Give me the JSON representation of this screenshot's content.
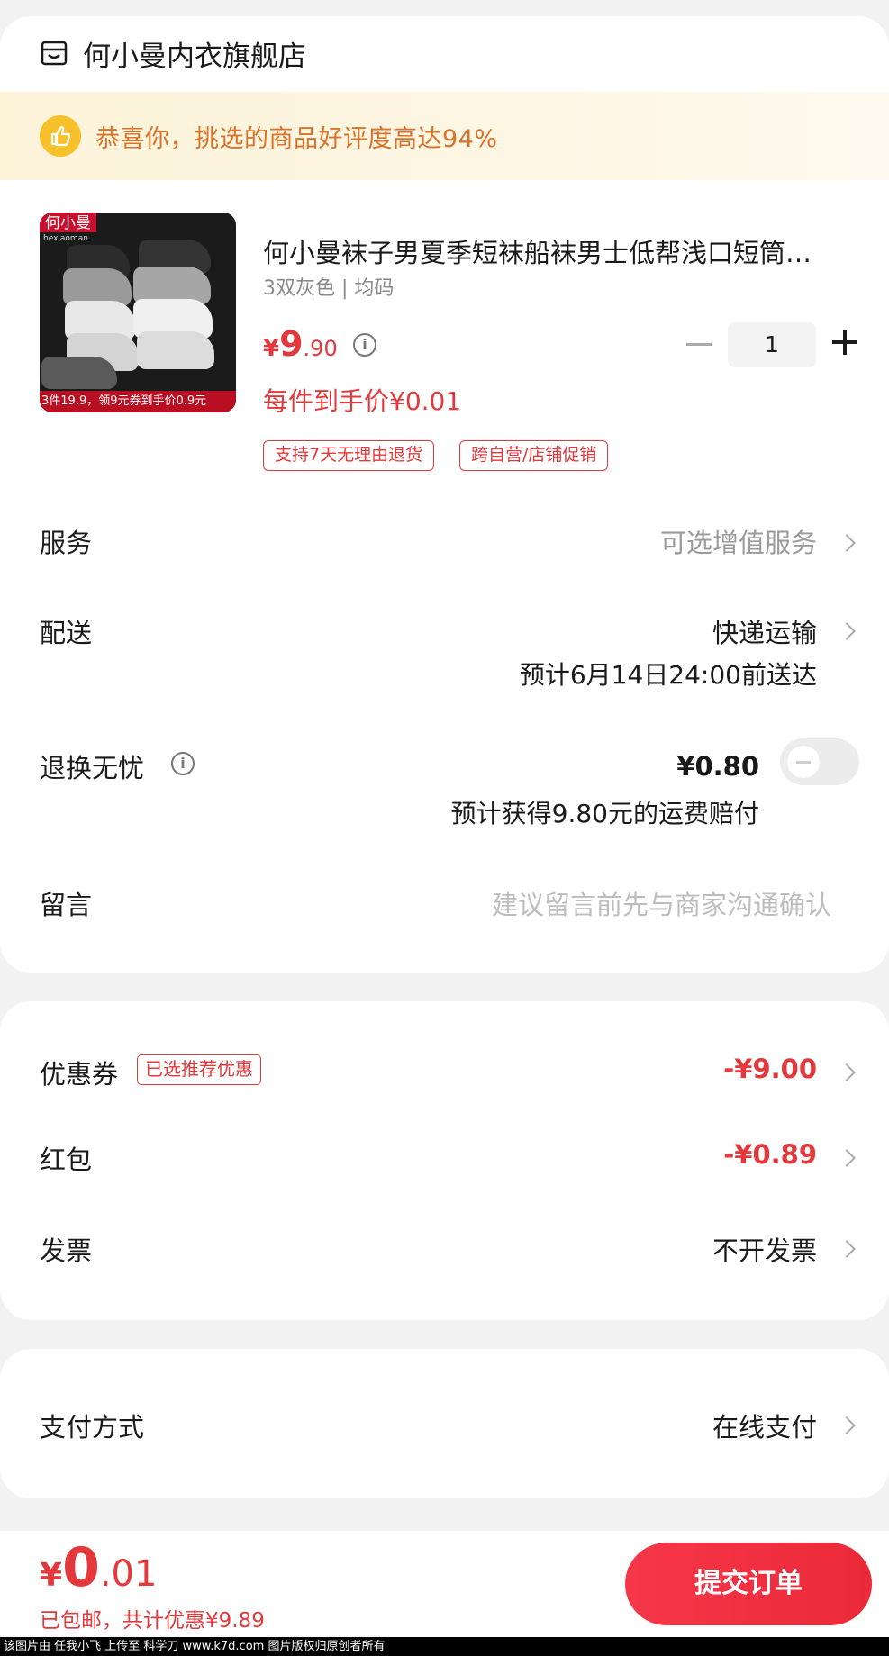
{
  "store": {
    "name": "何小曼内衣旗舰店",
    "icon": "store-icon"
  },
  "banner": {
    "text": "恭喜你，挑选的商品好评度高达94%",
    "icon": "thumbs-up-icon"
  },
  "product": {
    "image_brand": "何小曼",
    "image_brand_sub": "hexiaoman",
    "image_promo": "3件19.9，领9元券到手价0.9元",
    "title": "何小曼袜子男夏季短袜船袜男士低帮浅口短筒…",
    "sku": "3双灰色 | 均码",
    "price_symbol": "¥",
    "price_int": "9",
    "price_dec": ".90",
    "per_item_price": "每件到手价¥0.01",
    "tags": [
      "支持7天无理由退货",
      "跨自营/店铺促销"
    ],
    "quantity": "1"
  },
  "service": {
    "label": "服务",
    "value": "可选增值服务"
  },
  "delivery": {
    "label": "配送",
    "value": "快递运输",
    "eta": "预计6月14日24:00前送达"
  },
  "return": {
    "label": "退换无忧",
    "price": "¥0.80",
    "note": "预计获得9.80元的运费赔付",
    "enabled": false
  },
  "message": {
    "label": "留言",
    "placeholder": "建议留言前先与商家沟通确认"
  },
  "coupon": {
    "label": "优惠券",
    "tag": "已选推荐优惠",
    "value": "-¥9.00"
  },
  "red_packet": {
    "label": "红包",
    "value": "-¥0.89"
  },
  "invoice": {
    "label": "发票",
    "value": "不开发票"
  },
  "payment": {
    "label": "支付方式",
    "value": "在线支付"
  },
  "footer": {
    "total_symbol": "¥",
    "total_int": "0",
    "total_dec": ".01",
    "note": "已包邮，共计优惠¥9.89",
    "submit_label": "提交订单"
  },
  "watermark": "该图片由 任我小飞 上传至 科学刀 www.k7d.com 图片版权归原创者所有",
  "colors": {
    "accent": "#e4393c",
    "banner_text": "#d9732a",
    "banner_icon": "#f7c12c"
  }
}
